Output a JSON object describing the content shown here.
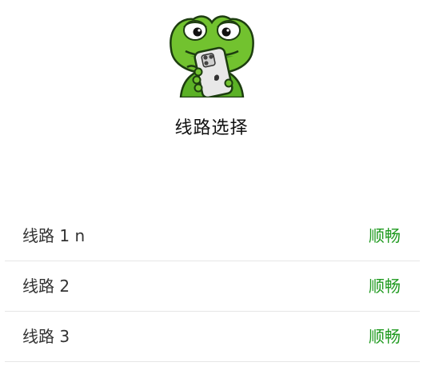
{
  "app": {
    "logo_icon": "frog-holding-phone-icon",
    "title": "线路选择"
  },
  "colors": {
    "status_good": "#1f9a1f",
    "frog_green": "#6fbf2e",
    "frog_dark": "#2f7a1a"
  },
  "lines": [
    {
      "name": "线路 1 n",
      "status": "顺畅"
    },
    {
      "name": "线路 2",
      "status": "顺畅"
    },
    {
      "name": "线路 3",
      "status": "顺畅"
    }
  ]
}
